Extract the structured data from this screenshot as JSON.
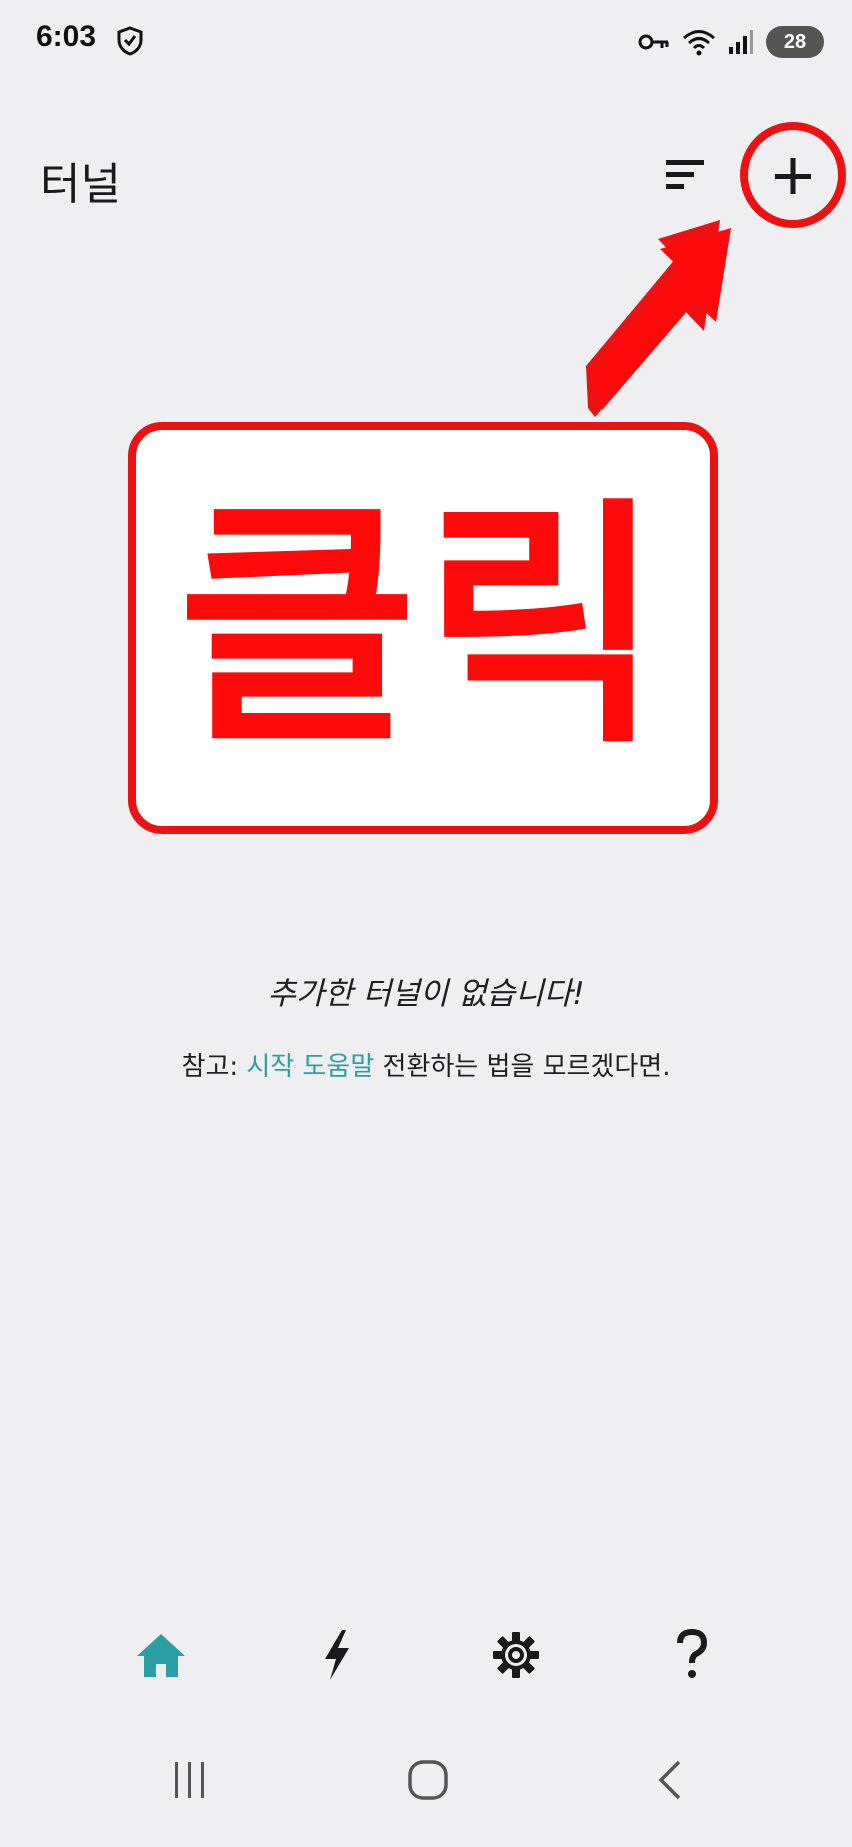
{
  "status_bar": {
    "time": "6:03",
    "battery_level": "28",
    "icons": [
      "shield-icon",
      "vpn-key-icon",
      "wifi-icon",
      "signal-icon",
      "battery-icon"
    ]
  },
  "app_bar": {
    "title": "터널",
    "sort_icon": "sort-icon",
    "add_icon": "plus-icon"
  },
  "annotation": {
    "callout_text": "클릭",
    "color": "#ee1111"
  },
  "empty_state": {
    "title": "추가한 터널이 없습니다!",
    "note_prefix": "참고: ",
    "note_link": "시작 도움말",
    "note_suffix": " 전환하는 법을 모르겠다면.",
    "link_color": "#2a9fa6"
  },
  "bottom_nav": {
    "items": [
      {
        "icon": "home-icon",
        "active": true
      },
      {
        "icon": "bolt-icon",
        "active": false
      },
      {
        "icon": "gear-icon",
        "active": false
      },
      {
        "icon": "question-icon",
        "active": false
      }
    ],
    "active_color": "#2a9fa6"
  },
  "system_nav": {
    "items": [
      "recents-icon",
      "home-outline-icon",
      "back-icon"
    ]
  }
}
